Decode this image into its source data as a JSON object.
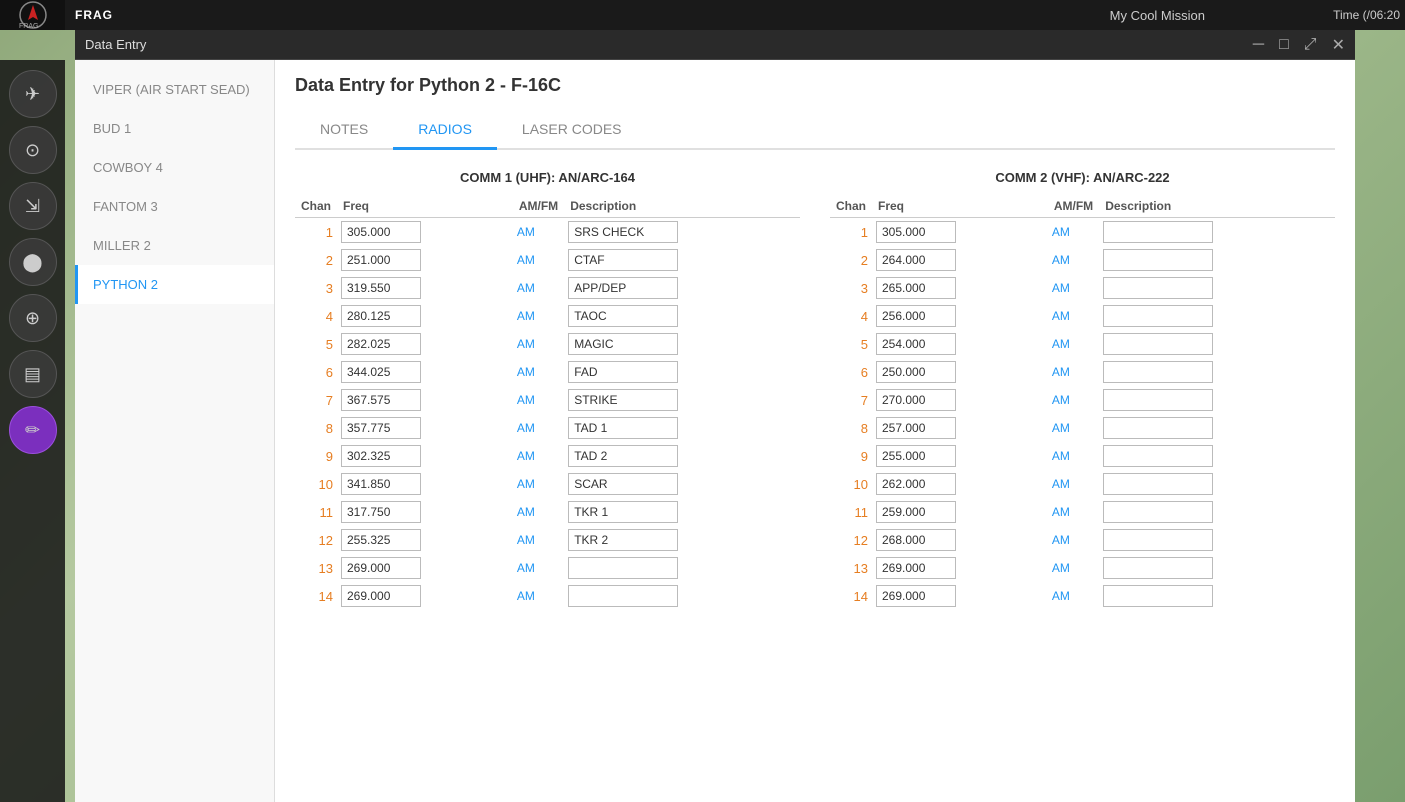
{
  "topBar": {
    "appName": "FRAG",
    "missionName": "My Cool Mission",
    "time": "Time (/06:20"
  },
  "window": {
    "title": "Data Entry",
    "minimizeLabel": "─",
    "restoreLabel": "□",
    "maximizeLabel": "⤢",
    "closeLabel": "✕"
  },
  "sidebarIcons": [
    {
      "name": "plane-icon",
      "symbol": "✈",
      "active": false
    },
    {
      "name": "radio-tower-icon",
      "symbol": "📡",
      "active": false
    },
    {
      "name": "landing-icon",
      "symbol": "✈",
      "active": false
    },
    {
      "name": "camera-icon",
      "symbol": "📷",
      "active": false
    },
    {
      "name": "target-icon",
      "symbol": "⊕",
      "active": false
    },
    {
      "name": "clipboard-icon",
      "symbol": "📋",
      "active": false
    },
    {
      "name": "edit-icon",
      "symbol": "✏",
      "active": true
    }
  ],
  "navItems": [
    {
      "label": "VIPER (AIR START SEAD)",
      "active": false
    },
    {
      "label": "BUD 1",
      "active": false
    },
    {
      "label": "COWBOY 4",
      "active": false
    },
    {
      "label": "FANTOM 3",
      "active": false
    },
    {
      "label": "MILLER 2",
      "active": false
    },
    {
      "label": "PYTHON 2",
      "active": true
    }
  ],
  "pageTitle": "Data Entry for Python 2 - F-16C",
  "tabs": [
    {
      "label": "NOTES",
      "active": false
    },
    {
      "label": "RADIOS",
      "active": true
    },
    {
      "label": "LASER CODES",
      "active": false
    }
  ],
  "comm1": {
    "title": "COMM 1 (UHF): AN/ARC-164",
    "columns": [
      "Chan",
      "Freq",
      "AM/FM",
      "Description"
    ],
    "rows": [
      {
        "chan": "1",
        "freq": "305.000",
        "amfm": "AM",
        "desc": "SRS CHECK"
      },
      {
        "chan": "2",
        "freq": "251.000",
        "amfm": "AM",
        "desc": "CTAF"
      },
      {
        "chan": "3",
        "freq": "319.550",
        "amfm": "AM",
        "desc": "APP/DEP"
      },
      {
        "chan": "4",
        "freq": "280.125",
        "amfm": "AM",
        "desc": "TAOC"
      },
      {
        "chan": "5",
        "freq": "282.025",
        "amfm": "AM",
        "desc": "MAGIC"
      },
      {
        "chan": "6",
        "freq": "344.025",
        "amfm": "AM",
        "desc": "FAD"
      },
      {
        "chan": "7",
        "freq": "367.575",
        "amfm": "AM",
        "desc": "STRIKE"
      },
      {
        "chan": "8",
        "freq": "357.775",
        "amfm": "AM",
        "desc": "TAD 1"
      },
      {
        "chan": "9",
        "freq": "302.325",
        "amfm": "AM",
        "desc": "TAD 2"
      },
      {
        "chan": "10",
        "freq": "341.850",
        "amfm": "AM",
        "desc": "SCAR"
      },
      {
        "chan": "11",
        "freq": "317.750",
        "amfm": "AM",
        "desc": "TKR 1"
      },
      {
        "chan": "12",
        "freq": "255.325",
        "amfm": "AM",
        "desc": "TKR 2"
      },
      {
        "chan": "13",
        "freq": "269.000",
        "amfm": "AM",
        "desc": ""
      },
      {
        "chan": "14",
        "freq": "269.000",
        "amfm": "AM",
        "desc": ""
      }
    ]
  },
  "comm2": {
    "title": "COMM 2 (VHF): AN/ARC-222",
    "columns": [
      "Chan",
      "Freq",
      "AM/FM",
      "Description"
    ],
    "rows": [
      {
        "chan": "1",
        "freq": "305.000",
        "amfm": "AM",
        "desc": ""
      },
      {
        "chan": "2",
        "freq": "264.000",
        "amfm": "AM",
        "desc": ""
      },
      {
        "chan": "3",
        "freq": "265.000",
        "amfm": "AM",
        "desc": ""
      },
      {
        "chan": "4",
        "freq": "256.000",
        "amfm": "AM",
        "desc": ""
      },
      {
        "chan": "5",
        "freq": "254.000",
        "amfm": "AM",
        "desc": ""
      },
      {
        "chan": "6",
        "freq": "250.000",
        "amfm": "AM",
        "desc": ""
      },
      {
        "chan": "7",
        "freq": "270.000",
        "amfm": "AM",
        "desc": ""
      },
      {
        "chan": "8",
        "freq": "257.000",
        "amfm": "AM",
        "desc": ""
      },
      {
        "chan": "9",
        "freq": "255.000",
        "amfm": "AM",
        "desc": ""
      },
      {
        "chan": "10",
        "freq": "262.000",
        "amfm": "AM",
        "desc": ""
      },
      {
        "chan": "11",
        "freq": "259.000",
        "amfm": "AM",
        "desc": ""
      },
      {
        "chan": "12",
        "freq": "268.000",
        "amfm": "AM",
        "desc": ""
      },
      {
        "chan": "13",
        "freq": "269.000",
        "amfm": "AM",
        "desc": ""
      },
      {
        "chan": "14",
        "freq": "269.000",
        "amfm": "AM",
        "desc": ""
      }
    ]
  }
}
